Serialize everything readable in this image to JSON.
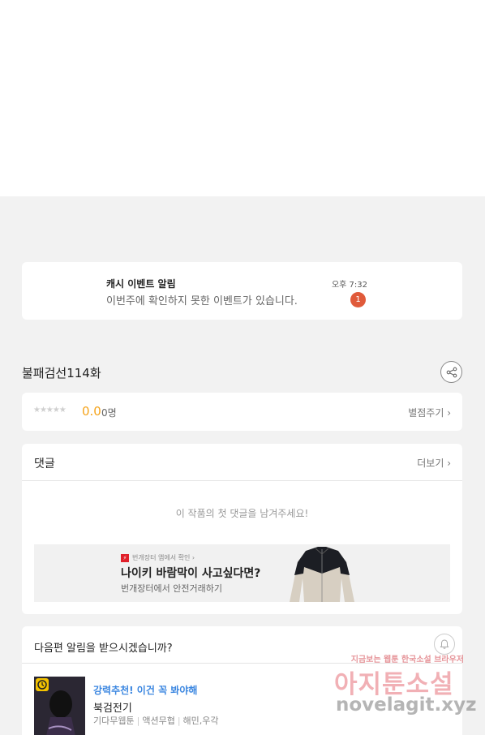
{
  "notification": {
    "title": "캐시 이벤트 알림",
    "message": "이번주에 확인하지 못한 이벤트가 있습니다.",
    "time": "오후 7:32",
    "badge_count": "1"
  },
  "episode": {
    "title": "불패검선114화",
    "share_icon": "share-icon"
  },
  "rating": {
    "stars": "★★★★★",
    "score": "0.0",
    "count": "0명",
    "rate_link": "별점주기 ›"
  },
  "comments": {
    "heading": "댓글",
    "more_link": "더보기 ›",
    "empty_message": "이 작품의 첫 댓글을 남겨주세요!",
    "ad": {
      "logo_glyph": "⚡",
      "source": "번개장터 앱에서 확인 ›",
      "title": "나이키 바람막이 사고싶다면?",
      "subtitle": "번개장터에서 안전거래하기"
    }
  },
  "next_notify": {
    "heading": "다음편 알림을 받으시겠습니까?",
    "bell_icon": "bell-icon",
    "recommend": {
      "tag": "강력추천! 이건 꼭 봐야해",
      "title": "북검전기",
      "meta": [
        "기다무웹툰",
        "액션무협",
        "해민,우각"
      ]
    }
  },
  "watermark": {
    "line1": "지금보는 웹툰 한국소설 브라우저",
    "line2": "아지툰소설",
    "line3": "novelagit.xyz"
  },
  "colors": {
    "accent_orange": "#f5a31a",
    "badge_red": "#e05a3a",
    "recommend_blue": "#3a86e0"
  }
}
